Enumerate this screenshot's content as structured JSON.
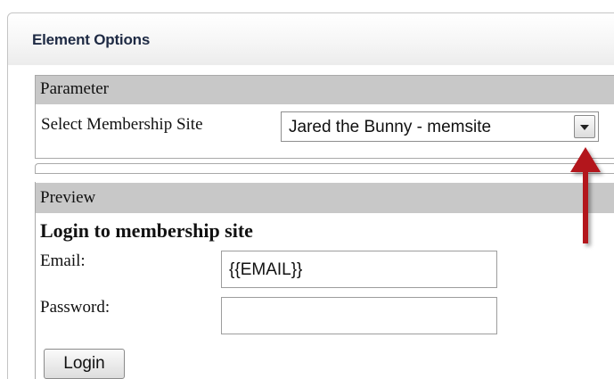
{
  "panel": {
    "title": "Element Options"
  },
  "parameter": {
    "section_label": "Parameter",
    "select_label": "Select Membership Site",
    "select_value": "Jared the Bunny - memsite"
  },
  "preview": {
    "section_label": "Preview",
    "heading": "Login to membership site",
    "email_label": "Email:",
    "email_value": "{{EMAIL}}",
    "password_label": "Password:",
    "password_value": "",
    "login_button": "Login"
  },
  "icons": {
    "dropdown": "chevron-down-icon",
    "annotation": "arrow-up-icon"
  },
  "colors": {
    "section_header_bg": "#c8c8c8",
    "arrow": "#b3141b"
  }
}
